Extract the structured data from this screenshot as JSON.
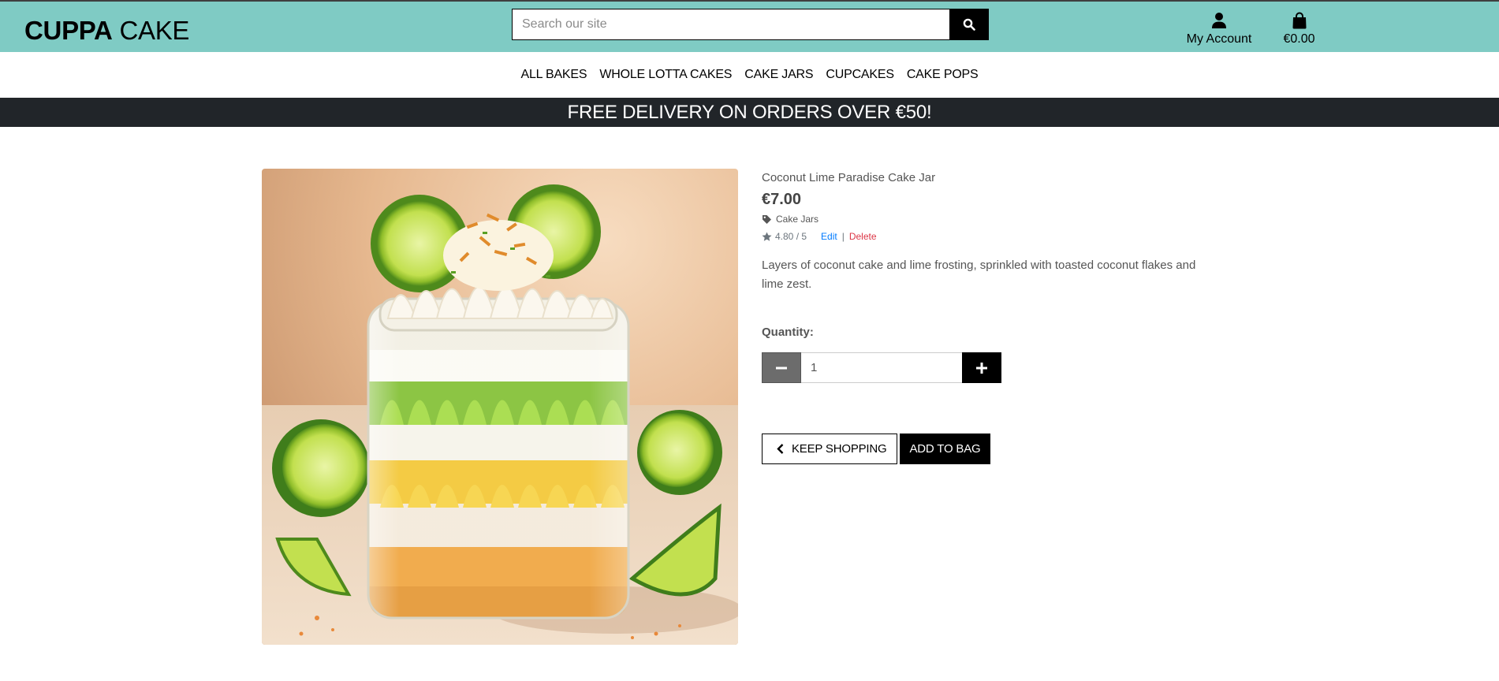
{
  "header": {
    "logo_bold": "CUPPA",
    "logo_light": "CAKE",
    "search_placeholder": "Search our site",
    "account_label": "My Account",
    "bag_total": "€0.00"
  },
  "nav": {
    "items": [
      "ALL BAKES",
      "WHOLE LOTTA CAKES",
      "CAKE JARS",
      "CUPCAKES",
      "CAKE POPS"
    ]
  },
  "banner": {
    "text": "FREE DELIVERY ON ORDERS OVER €50!"
  },
  "product": {
    "name": "Coconut Lime Paradise Cake Jar",
    "price": "€7.00",
    "category": "Cake Jars",
    "rating": "4.80 / 5",
    "edit_label": "Edit",
    "separator": "|",
    "delete_label": "Delete",
    "description": "Layers of coconut cake and lime frosting, sprinkled with toasted coconut flakes and lime zest.",
    "quantity_label": "Quantity:",
    "quantity_value": "1",
    "keep_shopping_label": "KEEP SHOPPING",
    "add_to_bag_label": "ADD TO BAG"
  },
  "colors": {
    "header_bg": "#7fcbc4",
    "banner_bg": "#212529",
    "edit_link": "#007bff",
    "delete_link": "#dc3545"
  },
  "icons": [
    "search-icon",
    "user-icon",
    "shopping-bag-icon",
    "tag-icon",
    "star-icon",
    "minus-icon",
    "plus-icon",
    "chevron-left-icon"
  ]
}
